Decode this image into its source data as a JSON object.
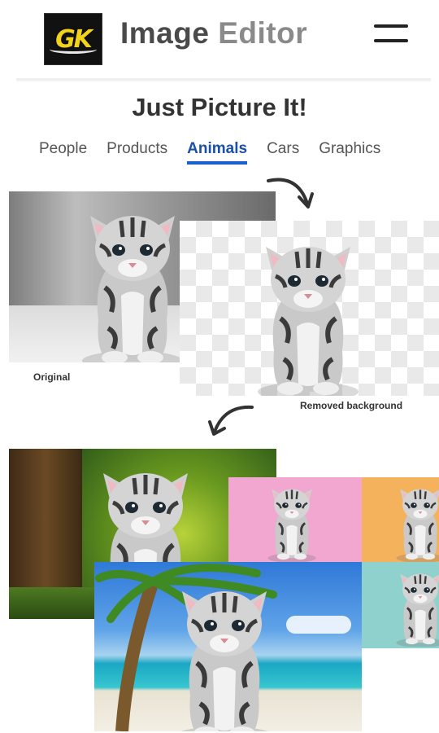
{
  "header": {
    "logo_text": "GK",
    "title_part1": "Image",
    "title_part2": "Editor"
  },
  "headline": "Just Picture It!",
  "tabs": [
    {
      "label": "People",
      "active": false
    },
    {
      "label": "Products",
      "active": false
    },
    {
      "label": "Animals",
      "active": true
    },
    {
      "label": "Cars",
      "active": false
    },
    {
      "label": "Graphics",
      "active": false
    }
  ],
  "captions": {
    "original": "Original",
    "removed": "Removed background"
  },
  "colors": {
    "active_tab": "#1b4fa8",
    "pink_bg": "#f1a7cf",
    "orange_bg": "#f5b25c",
    "teal_bg": "#8fd1cc"
  }
}
